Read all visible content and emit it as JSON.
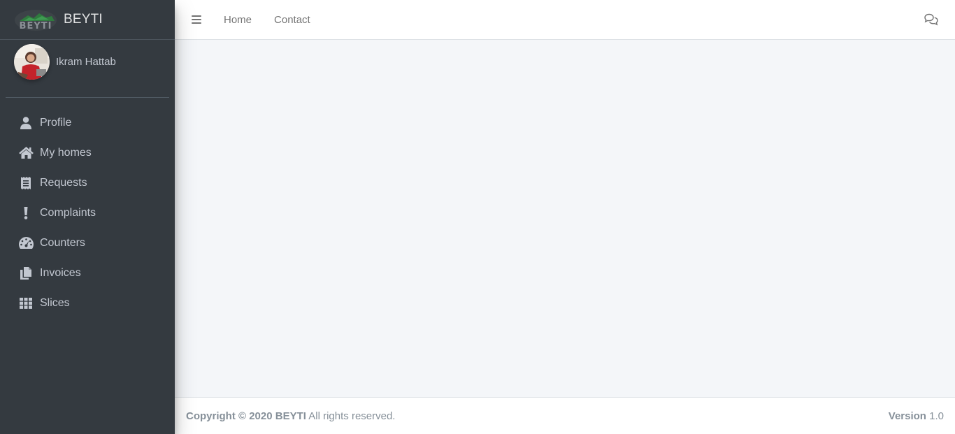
{
  "brand": {
    "name": "BEYTI",
    "logo_text": "BEYTI"
  },
  "user": {
    "name": "Ikram Hattab"
  },
  "sidebar": {
    "items": [
      {
        "label": "Profile",
        "icon": "user-icon"
      },
      {
        "label": "My homes",
        "icon": "home-icon"
      },
      {
        "label": "Requests",
        "icon": "receipt-icon"
      },
      {
        "label": "Complaints",
        "icon": "exclamation-icon"
      },
      {
        "label": "Counters",
        "icon": "gauge-icon"
      },
      {
        "label": "Invoices",
        "icon": "copy-icon"
      },
      {
        "label": "Slices",
        "icon": "grid-icon"
      }
    ]
  },
  "topbar": {
    "links": [
      {
        "label": "Home"
      },
      {
        "label": "Contact"
      }
    ],
    "menu_icon": "hamburger-icon",
    "chat_icon": "comments-icon"
  },
  "footer": {
    "copyright_bold": "Copyright © 2020 BEYTI",
    "copyright_rest": " All rights reserved.",
    "version_label": "Version",
    "version_value": " 1.0"
  },
  "colors": {
    "sidebar_bg": "#343a40",
    "content_bg": "#f4f6f9",
    "sidebar_text": "#c2c7d0"
  }
}
